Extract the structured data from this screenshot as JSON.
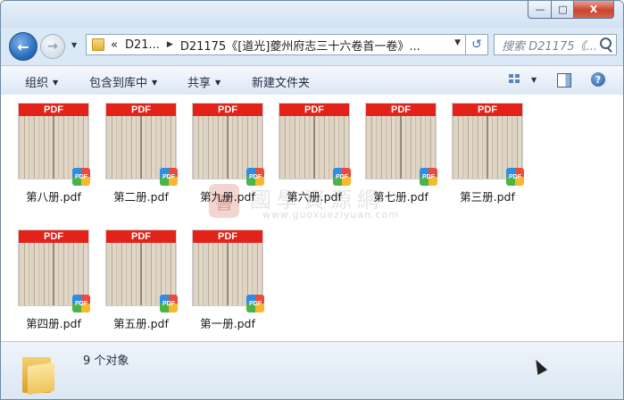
{
  "window": {
    "minimize": "—",
    "maximize": "□",
    "close": "X"
  },
  "nav": {
    "back": "←",
    "forward": "→",
    "address": {
      "prefix": "«",
      "segment1": "D21...",
      "segment2": "D21175《[道光]夔州府志三十六卷首一卷》..."
    },
    "refresh": "↺",
    "search_placeholder": "搜索 D21175《..."
  },
  "toolbar": {
    "organize": "组织",
    "include_in_library": "包含到库中",
    "share": "共享",
    "new_folder": "新建文件夹",
    "help": "?"
  },
  "files": [
    {
      "name": "第八册.pdf"
    },
    {
      "name": "第二册.pdf"
    },
    {
      "name": "第九册.pdf"
    },
    {
      "name": "第六册.pdf"
    },
    {
      "name": "第七册.pdf"
    },
    {
      "name": "第三册.pdf"
    },
    {
      "name": "第四册.pdf"
    },
    {
      "name": "第五册.pdf"
    },
    {
      "name": "第一册.pdf"
    }
  ],
  "thumb_band_text": "PDF",
  "badge_text": "PDF",
  "watermark": {
    "chinese": "國學資源網",
    "url": "www.guoxueziyuan.com",
    "seal": "書"
  },
  "status": {
    "count_text": "9 个对象"
  }
}
